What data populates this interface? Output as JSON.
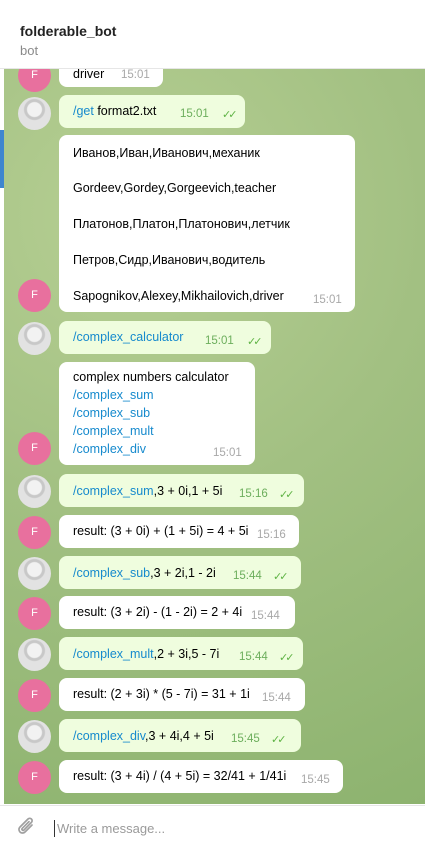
{
  "header": {
    "title": "folderable_bot",
    "subtitle": "bot"
  },
  "avatar_letter": "F",
  "messages": [
    {
      "lines": [
        "driver"
      ],
      "time": "15:01"
    },
    {
      "link": "/get",
      "rest": " format2.txt",
      "time": "15:01"
    },
    {
      "lines": [
        "Иванов,Иван,Иванович,механик",
        "Gordeev,Gordey,Gorgeevich,teacher",
        "Платонов,Платон,Платонович,летчик",
        "Петров,Сидр,Иванович,водитель",
        "Sapognikov,Alexey,Mikhailovich,driver"
      ],
      "time": "15:01"
    },
    {
      "link": "/complex_calculator",
      "rest": "",
      "time": "15:01"
    },
    {
      "title": "complex numbers calculator",
      "links": [
        "/complex_sum",
        "/complex_sub",
        "/complex_mult",
        "/complex_div"
      ],
      "time": "15:01"
    },
    {
      "link": "/complex_sum",
      "rest": ",3 + 0i,1 + 5i",
      "time": "15:16"
    },
    {
      "text": "result: (3 + 0i) + (1 + 5i) = 4 + 5i",
      "time": "15:16"
    },
    {
      "link": "/complex_sub",
      "rest": ",3 + 2i,1 - 2i",
      "time": "15:44"
    },
    {
      "text": "result: (3 + 2i) - (1 - 2i) = 2 + 4i",
      "time": "15:44"
    },
    {
      "link": "/complex_mult",
      "rest": ",2 + 3i,5 - 7i",
      "time": "15:44"
    },
    {
      "text": "result: (2 + 3i) * (5 - 7i) = 31 + 1i",
      "time": "15:44"
    },
    {
      "link": "/complex_div",
      "rest": ",3 + 4i,4 + 5i",
      "time": "15:45"
    },
    {
      "text": "result: (3 + 4i) / (4 + 5i) = 32/41 + 1/41i",
      "time": "15:45"
    }
  ],
  "read_status": "✓✓",
  "composer": {
    "placeholder": "Write a message...",
    "attach_icon": "paperclip-icon"
  },
  "colors": {
    "outgoing": "#effdde",
    "incoming": "#ffffff",
    "link": "#168acd",
    "avatar": "#e8709e",
    "background": "#a2c082"
  }
}
